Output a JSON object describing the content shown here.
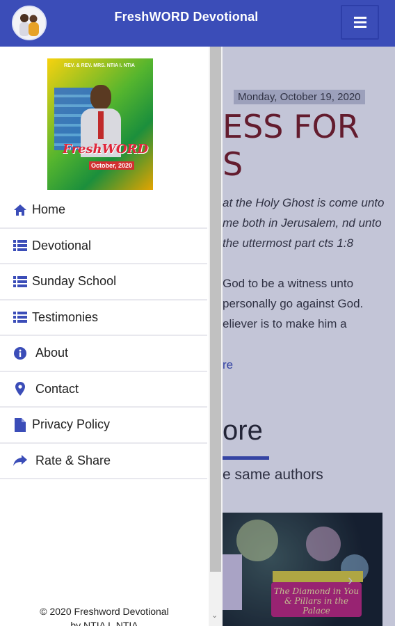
{
  "app": {
    "title": "FreshWORD Devotional",
    "accent": "#3b4db8"
  },
  "background": {
    "date": "Monday, October 19, 2020",
    "heading_line1": "ESS FOR",
    "heading_line2": "S",
    "verse": "at the Holy Ghost is come unto me both in Jerusalem, nd unto the uttermost part cts 1:8",
    "body": "God to be a witness unto personally go against God. eliever is to make him a",
    "read_more": "re",
    "more_heading": "ore",
    "subtitle": "e same authors",
    "promo_text": "The Diamond in You & Pillars in the Palace"
  },
  "drawer": {
    "cover": {
      "banner": "REV. & REV. MRS. NTIA I. NTIA",
      "brand": "FreshWORD",
      "month": "October, 2020"
    },
    "nav": [
      {
        "label": "Home",
        "icon": "home-icon"
      },
      {
        "label": "Devotional",
        "icon": "list-icon"
      },
      {
        "label": "Sunday School",
        "icon": "list-icon"
      },
      {
        "label": "Testimonies",
        "icon": "list-icon"
      },
      {
        "label": "About",
        "icon": "info-icon"
      },
      {
        "label": "Contact",
        "icon": "location-pin-icon"
      },
      {
        "label": "Privacy Policy",
        "icon": "document-icon"
      },
      {
        "label": "Rate & Share",
        "icon": "share-icon"
      }
    ],
    "footer_line1": "© 2020 Freshword Devotional",
    "footer_line2": "by NTIA I. NTIA"
  }
}
